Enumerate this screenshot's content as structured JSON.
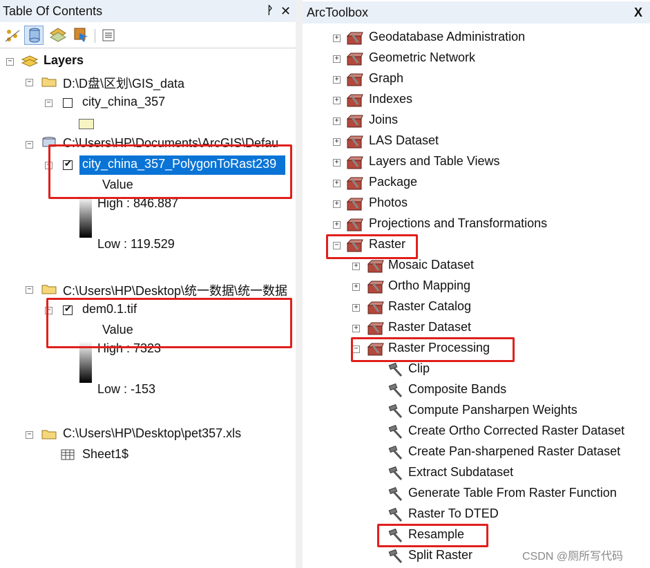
{
  "toc": {
    "title": "Table Of Contents",
    "pin_icon": "pin-icon",
    "close_label": "✕",
    "layers_label": "Layers",
    "groups": [
      {
        "path": "D:\\D盘\\区划\\GIS_data",
        "layer": "city_china_357",
        "checked": false
      },
      {
        "path": "C:\\Users\\HP\\Documents\\ArcGIS\\Defau",
        "layer": "city_china_357_PolygonToRast239",
        "checked": true,
        "legend_title": "Value",
        "high": "High : 846.887",
        "low": "Low : 119.529"
      },
      {
        "path": "C:\\Users\\HP\\Desktop\\统一数据\\统一数据",
        "layer": "dem0.1.tif",
        "checked": true,
        "legend_title": "Value",
        "high": "High : 7323",
        "low": "Low : -153"
      },
      {
        "path": "C:\\Users\\HP\\Desktop\\pet357.xls",
        "layer": "Sheet1$"
      }
    ]
  },
  "toolbox": {
    "title": "ArcToolbox",
    "toolsets": [
      "Geodatabase Administration",
      "Geometric Network",
      "Graph",
      "Indexes",
      "Joins",
      "LAS Dataset",
      "Layers and Table Views",
      "Package",
      "Photos",
      "Projections and Transformations",
      "Raster"
    ],
    "raster_children": [
      "Mosaic Dataset",
      "Ortho Mapping",
      "Raster Catalog",
      "Raster Dataset",
      "Raster Processing"
    ],
    "tools": [
      "Clip",
      "Composite Bands",
      "Compute Pansharpen Weights",
      "Create Ortho Corrected Raster Dataset",
      "Create Pan-sharpened Raster Dataset",
      "Extract Subdataset",
      "Generate Table From Raster Function",
      "Raster To DTED",
      "Resample",
      "Split Raster"
    ]
  },
  "watermark": "CSDN @厕所写代码",
  "colors": {
    "highlight": "#0a74d6",
    "annotation_red": "#e0201c"
  }
}
